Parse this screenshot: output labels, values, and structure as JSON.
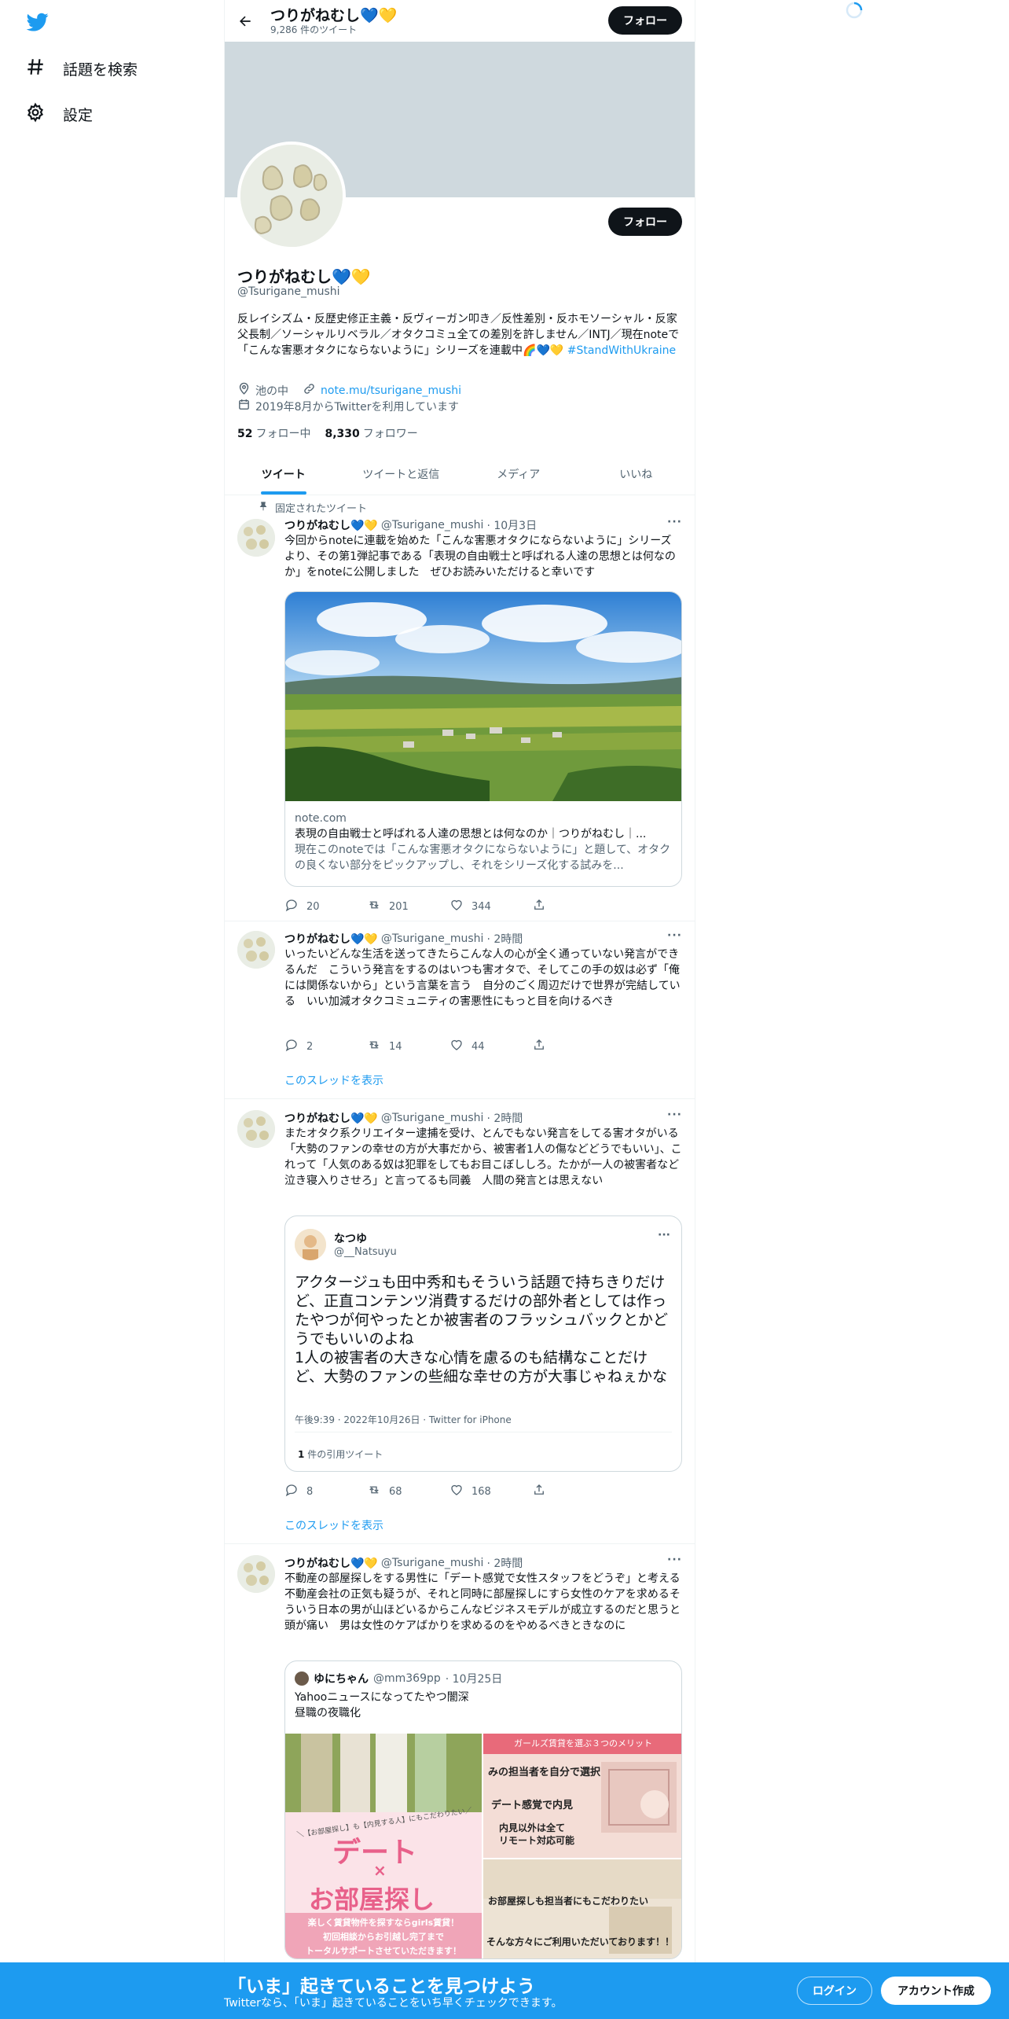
{
  "nav": {
    "explore_label": "話題を検索",
    "settings_label": "設定"
  },
  "header": {
    "name": "つりがねむし💙💛",
    "tweet_count": "9,286 件のツイート",
    "follow_label": "フォロー"
  },
  "profile": {
    "name": "つりがねむし💙💛",
    "handle": "@Tsurigane_mushi",
    "follow_label": "フォロー",
    "bio": "反レイシズム・反歴史修正主義・反ヴィーガン叩き／反性差別・反ホモソーシャル・反家父長制／ソーシャルリベラル／オタクコミュ全ての差別を許しません／INTJ／現在noteで「こんな害悪オタクにならないように」シリーズを連載中🌈💙💛",
    "hashtag": "#StandWithUkraine",
    "location": "池の中",
    "website": "note.mu/tsurigane_mushi",
    "joined": "2019年8月からTwitterを利用しています",
    "following_count": "52",
    "following_label": "フォロー中",
    "followers_count": "8,330",
    "followers_label": "フォロワー"
  },
  "tabs": [
    "ツイート",
    "ツイートと返信",
    "メディア",
    "いいね"
  ],
  "pinned_label": "固定されたツイート",
  "tweets": [
    {
      "name": "つりがねむし💙💛",
      "handle": "@Tsurigane_mushi",
      "time": "· 10月3日",
      "text": "今回からnoteに連載を始めた「こんな害悪オタクにならないように」シリーズより、その第1弾記事である「表現の自由戦士と呼ばれる人達の思想とは何なのか」をnoteに公開しました　ぜひお読みいただけると幸いです",
      "card": {
        "domain": "note.com",
        "title": "表現の自由戦士と呼ばれる人達の思想とは何なのか｜つりがねむし｜...",
        "desc": "現在このnoteでは「こんな害悪オタクにならないように」と題して、オタクの良くない部分をピックアップし、それをシリーズ化する試みを..."
      },
      "replies": "20",
      "retweets": "201",
      "likes": "344"
    },
    {
      "name": "つりがねむし💙💛",
      "handle": "@Tsurigane_mushi",
      "time": "· 2時間",
      "text": "いったいどんな生活を送ってきたらこんな人の心が全く通っていない発言ができるんだ　こういう発言をするのはいつも害オタで、そしてこの手の奴は必ず「俺には関係ないから」という言葉を言う　自分のごく周辺だけで世界が完結している　いい加減オタクコミュニティの害悪性にもっと目を向けるべき",
      "replies": "2",
      "retweets": "14",
      "likes": "44",
      "thread": "このスレッドを表示"
    },
    {
      "name": "つりがねむし💙💛",
      "handle": "@Tsurigane_mushi",
      "time": "· 2時間",
      "text": "またオタク系クリエイター逮捕を受け、とんでもない発言をしてる害オタがいる　「大勢のファンの幸せの方が大事だから、被害者1人の傷などどうでもいい」、これって「人気のある奴は犯罪をしてもお目こぼししろ。たかが一人の被害者など泣き寝入りさせろ」と言ってるも同義　人間の発言とは思えない",
      "quote": {
        "name": "なつゆ",
        "handle": "@__Natsuyu",
        "text": "アクタージュも田中秀和もそういう話題で持ちきりだけど、正直コンテンツ消費するだけの部外者としては作ったやつが何やったとか被害者のフラッシュバックとかどうでもいいのよね\n1人の被害者の大きな心情を慮るのも結構なことだけど、大勢のファンの些細な幸せの方が大事じゃねぇかな",
        "meta": "午後9:39 · 2022年10月26日 · Twitter for iPhone",
        "quote_count": "1",
        "quote_label": "件の引用ツイート"
      },
      "replies": "8",
      "retweets": "68",
      "likes": "168",
      "thread": "このスレッドを表示"
    },
    {
      "name": "つりがねむし💙💛",
      "handle": "@Tsurigane_mushi",
      "time": "· 2時間",
      "text": "不動産の部屋探しをする男性に「デート感覚で女性スタッフをどうぞ」と考える不動産会社の正気も疑うが、それと同時に部屋探しにすら女性のケアを求めるそういう日本の男が山ほどいるからこんなビジネスモデルが成立するのだと思うと頭が痛い　男は女性のケアばかりを求めるのをやめるべきときなのに",
      "quote": {
        "name": "ゆにちゃん",
        "handle": "@mm369pp",
        "time": "· 10月25日",
        "text": "Yahooニュースになってたやつ闇深\n昼職の夜職化",
        "img_left_small": "＼【お部屋探し】も【内見する人】にもこだわりたい／",
        "img_left_big1": "デート",
        "img_left_x": "×",
        "img_left_big2": "お部屋探し",
        "img_left_foot": "楽しく賃貸物件を探すならgirls賃貸！\n初回相談からお引越し完了まで\nトータルサポートさせていただきます！",
        "img_right_head": "ガールズ賃貸を選ぶ３つのメリット",
        "img_right_l1": "みの担当者を自分で選択",
        "img_right_l2": "デート感覚で内見",
        "img_right_l3": "内見以外は全て\nリモート対応可能",
        "img_right_b1": "お部屋探しも担当者にもこだわりたい",
        "img_right_b2": "そんな方々にご利用いただいております！！"
      }
    }
  ],
  "bottom_banner": {
    "title": "「いま」起きていることを見つけよう",
    "subtitle": "Twitterなら、「いま」起きていることをいち早くチェックできます。",
    "login_label": "ログイン",
    "signup_label": "アカウント作成"
  },
  "colors": {
    "accent": "#1d9bf0",
    "text": "#0f1419",
    "muted": "#536471",
    "banner": "#cfd9de"
  }
}
